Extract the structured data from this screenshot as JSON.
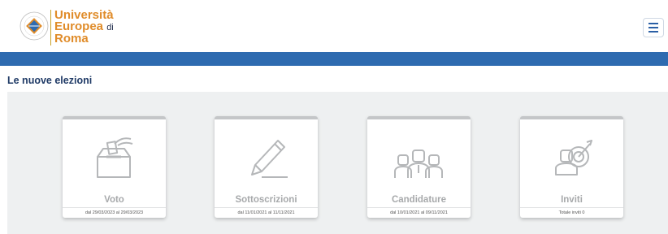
{
  "header": {
    "logo": {
      "line1": "Università",
      "line2": "Europea",
      "line2_suffix": "di",
      "line3": "Roma",
      "seal_text": "REGNUM CHRISTI · INSTITUTA"
    },
    "menu_icon": "hamburger-icon"
  },
  "page": {
    "title": "Le nuove elezioni"
  },
  "cards": [
    {
      "icon": "ballot-box-icon",
      "title": "Voto",
      "footer": "dal 29/03/2023 al 29/03/2023"
    },
    {
      "icon": "pen-icon",
      "title": "Sottoscrizioni",
      "footer": "dal 11/01/2021 al 11/11/2021"
    },
    {
      "icon": "candidates-icon",
      "title": "Candidature",
      "footer": "dal 10/01/2021 al 09/11/2021"
    },
    {
      "icon": "invite-target-icon",
      "title": "Inviti",
      "footer": "Totale inviti 0"
    }
  ],
  "colors": {
    "brand_blue": "#2e6bb0",
    "accent_orange": "#e08c2a",
    "title_navy": "#1f3a66",
    "panel_bg": "#eef0f1"
  }
}
